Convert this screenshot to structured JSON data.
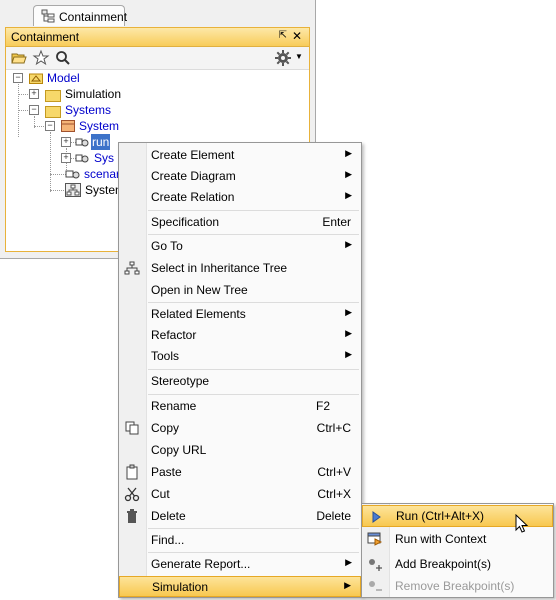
{
  "panel": {
    "tab_label": "Containment",
    "title": "Containment",
    "pin_glyph": "⇱",
    "close_glyph": "✕"
  },
  "toolbar": {
    "icons": [
      "open-folder-icon",
      "star-icon",
      "search-icon",
      "gear-icon"
    ]
  },
  "tree": {
    "model": "Model",
    "simulation": "Simulation",
    "systems": "Systems",
    "system": "System",
    "run": "run",
    "sys_child": "Sys",
    "scenario": "scenar",
    "system_black": "System"
  },
  "menu": {
    "create_element": "Create Element",
    "create_diagram": "Create Diagram",
    "create_relation": "Create Relation",
    "specification": "Specification",
    "specification_sc": "Enter",
    "go_to": "Go To",
    "select_inheritance": "Select in Inheritance Tree",
    "open_new_tree": "Open in New Tree",
    "related_elements": "Related Elements",
    "refactor": "Refactor",
    "tools": "Tools",
    "stereotype": "Stereotype",
    "rename": "Rename",
    "rename_sc": "F2",
    "copy": "Copy",
    "copy_sc": "Ctrl+C",
    "copy_url": "Copy URL",
    "paste": "Paste",
    "paste_sc": "Ctrl+V",
    "cut": "Cut",
    "cut_sc": "Ctrl+X",
    "delete": "Delete",
    "delete_sc": "Delete",
    "find": "Find...",
    "generate_report": "Generate Report...",
    "simulation": "Simulation"
  },
  "submenu": {
    "run": "Run (Ctrl+Alt+X)",
    "run_with_context": "Run with Context",
    "add_breakpoints": "Add Breakpoint(s)",
    "remove_breakpoints": "Remove Breakpoint(s)"
  },
  "colors": {
    "highlight": "#f8c850",
    "frame_border": "#e8b23a",
    "link_text": "#0000cc"
  }
}
